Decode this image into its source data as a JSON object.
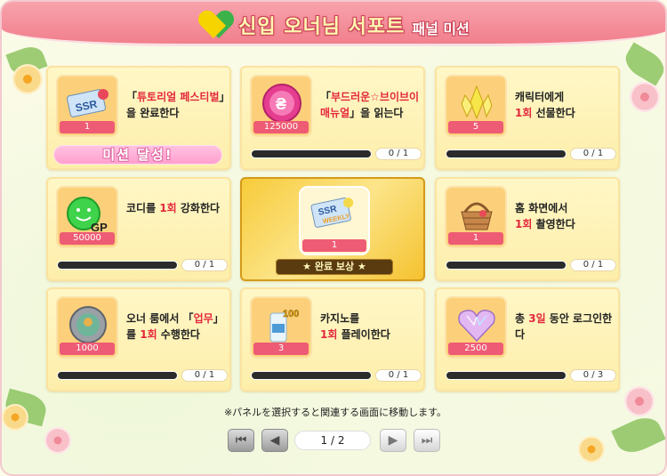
{
  "header": {
    "title": "신입 오너님 서포트",
    "subtitle": "패널 미션"
  },
  "panels": [
    {
      "desc_html": "「<span class='hl'>튜토리얼 페스티벌</span>」을 완료한다",
      "count": "1",
      "icon": "ssr-ticket-icon",
      "status": "미션 달성!"
    },
    {
      "desc_html": "「<span class='hl'>부드러운☆브이브이 매뉴얼</span>」을 읽는다",
      "count": "125000",
      "icon": "coin-icon",
      "progress": "0 / 1",
      "fraction": 0
    },
    {
      "desc_html": "캐릭터에게<br><span class='hl'>1회</span> 선물한다",
      "count": "5",
      "icon": "crystal-icon",
      "progress": "0 / 1",
      "fraction": 0
    },
    {
      "desc_html": "코디를 <span class='hl'>1회</span> 강화한다",
      "count": "50000",
      "icon": "gp-icon",
      "progress": "0 / 1",
      "fraction": 0
    },
    {
      "center": true,
      "count": "1",
      "icon": "ssr-weekly-ticket-icon",
      "banner": "★ 완료 보상 ★"
    },
    {
      "desc_html": "홈 화면에서<br><span class='hl'>1회</span> 촬영한다",
      "count": "1",
      "icon": "basket-icon",
      "progress": "0 / 1",
      "fraction": 0
    },
    {
      "desc_html": "오너 룸에서 「<span class='hl'>업무</span>」를 <span class='hl'>1회</span> 수행한다",
      "count": "1000",
      "icon": "medal-icon",
      "progress": "0 / 1",
      "fraction": 0
    },
    {
      "desc_html": "카지노를<br><span class='hl'>1회</span> 플레이한다",
      "count": "3",
      "icon": "drink-icon",
      "progress": "0 / 1",
      "fraction": 0
    },
    {
      "desc_html": "총 <span class='hl'>3일</span> 동안 로그인한다",
      "count": "2500",
      "icon": "heart-gem-icon",
      "progress": "0 / 3",
      "fraction": 0
    }
  ],
  "note": "※パネルを選択すると関連する画面に移動します。",
  "pager": {
    "page_text": "1  /  2"
  },
  "colors": {
    "header": "#f17f8c",
    "panel": "#fdeeaa",
    "accent": "#e3283c",
    "tag": "#ee5b74"
  }
}
